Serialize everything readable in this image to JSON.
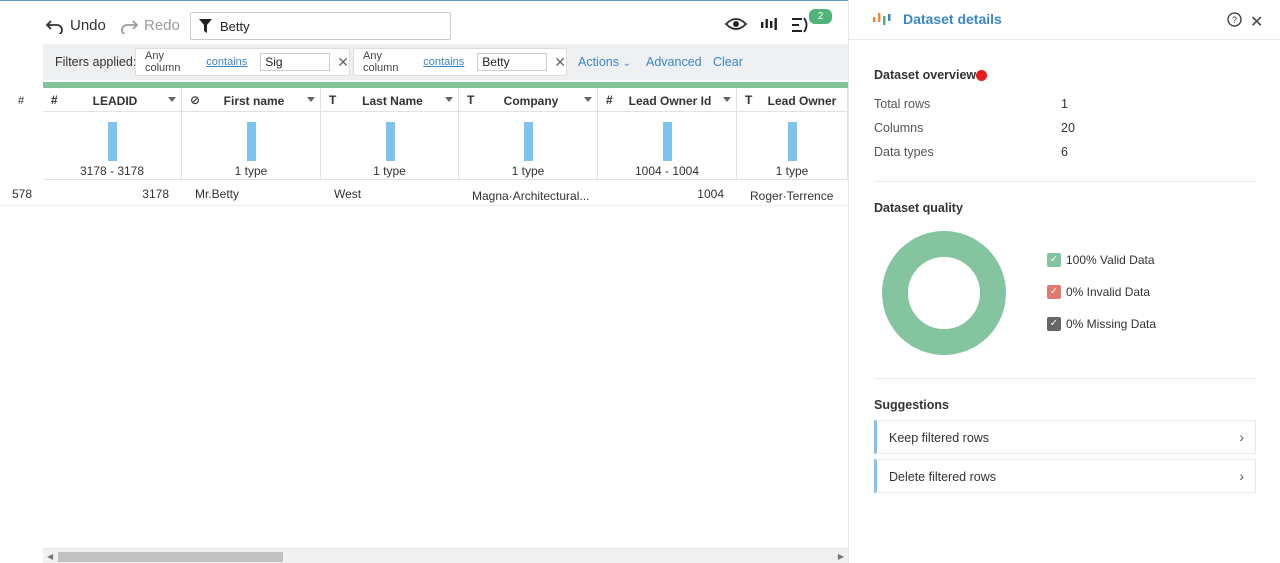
{
  "toolbar": {
    "undo_label": "Undo",
    "redo_label": "Redo",
    "search_value": "Betty",
    "badge_count": "2"
  },
  "filters": {
    "label": "Filters applied:",
    "chips": [
      {
        "column": "Any column",
        "op": "contains",
        "value": "Sig"
      },
      {
        "column": "Any column",
        "op": "contains",
        "value": "Betty"
      }
    ],
    "actions_label": "Actions",
    "advanced_label": "Advanced",
    "clear_label": "Clear"
  },
  "grid": {
    "rownum_header": "#",
    "columns": [
      {
        "type_icon": "#",
        "name": "LEADID",
        "summary": "3178 - 3178"
      },
      {
        "type_icon": "⊘",
        "name": "First name",
        "summary": "1 type"
      },
      {
        "type_icon": "T",
        "name": "Last Name",
        "summary": "1 type"
      },
      {
        "type_icon": "T",
        "name": "Company",
        "summary": "1 type"
      },
      {
        "type_icon": "#",
        "name": "Lead Owner Id",
        "summary": "1004 - 1004"
      },
      {
        "type_icon": "T",
        "name": "Lead Owner",
        "summary": "1 type"
      }
    ],
    "rows": [
      {
        "rownum": "578",
        "cells": [
          "3178",
          "Mr.Betty",
          "West",
          "Magna·Architectural...",
          "1004",
          "Roger·Terrence"
        ]
      }
    ]
  },
  "panel": {
    "title": "Dataset details",
    "overview_title": "Dataset overview",
    "stats": [
      {
        "label": "Total rows",
        "value": "1"
      },
      {
        "label": "Columns",
        "value": "20"
      },
      {
        "label": "Data types",
        "value": "6"
      }
    ],
    "quality_title": "Dataset quality",
    "quality": {
      "valid_pct": 100,
      "invalid_pct": 0,
      "missing_pct": 0,
      "valid_label": "100% Valid Data",
      "invalid_label": "0% Invalid Data",
      "missing_label": "0% Missing Data",
      "colors": {
        "valid": "#84c49f",
        "invalid": "#e07a6e",
        "missing": "#666666"
      }
    },
    "suggestions_title": "Suggestions",
    "suggestions": [
      "Keep filtered rows",
      "Delete filtered rows"
    ]
  },
  "colors": {
    "accent": "#3b86c6",
    "green_bar": "#82c39a",
    "histogram": "#7ec2ee",
    "status_dot": "#e81d1d",
    "badge": "#4fb37a"
  }
}
